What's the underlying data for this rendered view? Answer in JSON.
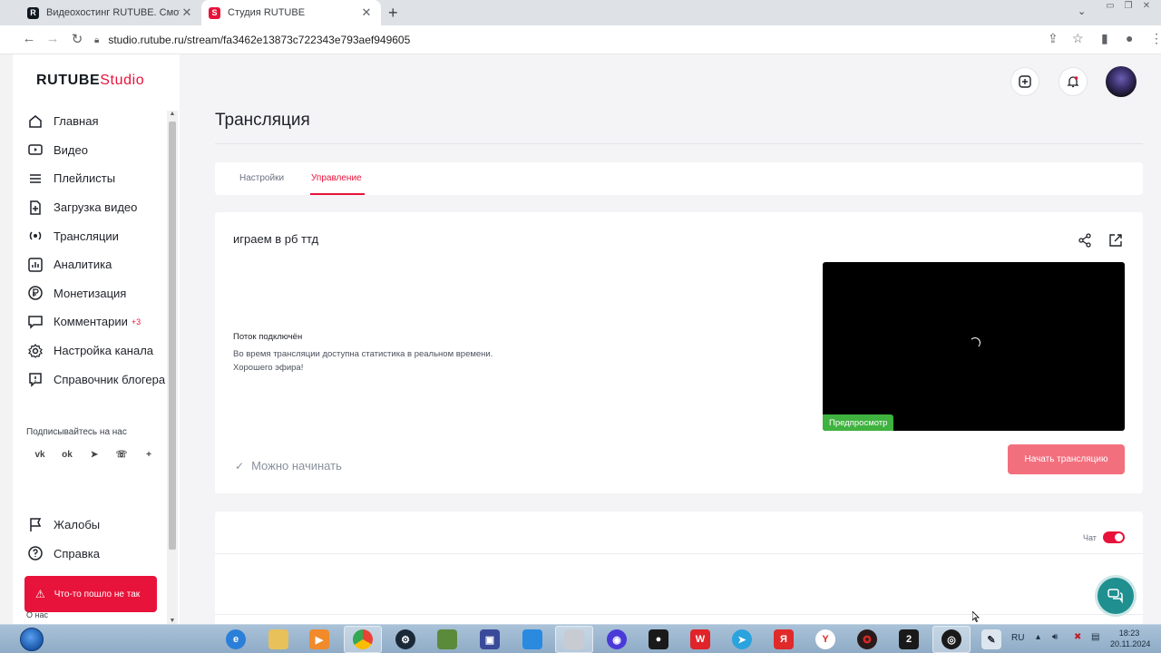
{
  "browser": {
    "tabs": [
      {
        "title": "Видеохостинг RUTUBE. Смотрите",
        "favicon": "rutube-icon",
        "color": "#101820"
      },
      {
        "title": "Студия RUTUBE",
        "favicon": "rutube-studio-icon",
        "color": "#e8133a"
      }
    ],
    "url": "studio.rutube.ru/stream/fa3462e13873c722343e793aef949605"
  },
  "logo": {
    "word": "RUTUBE",
    "suffix": "Studio"
  },
  "sidebar": {
    "items": [
      {
        "label": "Главная",
        "icon": "home-icon"
      },
      {
        "label": "Видео",
        "icon": "video-icon"
      },
      {
        "label": "Плейлисты",
        "icon": "playlist-icon"
      },
      {
        "label": "Загрузка видео",
        "icon": "upload-icon"
      },
      {
        "label": "Трансляции",
        "icon": "broadcast-icon"
      },
      {
        "label": "Аналитика",
        "icon": "analytics-icon"
      },
      {
        "label": "Монетизация",
        "icon": "ruble-icon"
      },
      {
        "label": "Комментарии",
        "icon": "comment-icon",
        "badge": "+3"
      },
      {
        "label": "Настройка канала",
        "icon": "gear-icon"
      },
      {
        "label": "Справочник блогера",
        "icon": "info-icon"
      }
    ],
    "subscribe_label": "Подписывайтесь на нас",
    "socials": [
      "vk-icon",
      "ok-icon",
      "telegram-icon",
      "viber-icon",
      "plus-icon"
    ],
    "bottom_items": [
      {
        "label": "Жалобы",
        "icon": "flag-icon"
      },
      {
        "label": "Справка",
        "icon": "help-icon"
      }
    ],
    "about": "О нас"
  },
  "error_toast": "Что-то пошло не так",
  "page": {
    "title": "Трансляция",
    "tabs": [
      {
        "label": "Настройки",
        "active": false
      },
      {
        "label": "Управление",
        "active": true
      }
    ]
  },
  "stream": {
    "name": "играем в рб ттд",
    "status_title": "Поток подключён",
    "status_line1": "Во время трансляции доступна статистика в реальном времени.",
    "status_line2": "Хорошего эфира!",
    "preview_label": "Предпросмотр",
    "ready_label": "Можно начинать",
    "start_button": "Начать трансляцию"
  },
  "chat": {
    "label": "Чат",
    "enabled": true
  },
  "taskbar": {
    "lang": "RU",
    "time": "18:23",
    "date": "20.11.2024"
  },
  "colors": {
    "brand": "#e8133a",
    "start_button": "#f26f7d",
    "preview_badge": "#3fb23f"
  }
}
